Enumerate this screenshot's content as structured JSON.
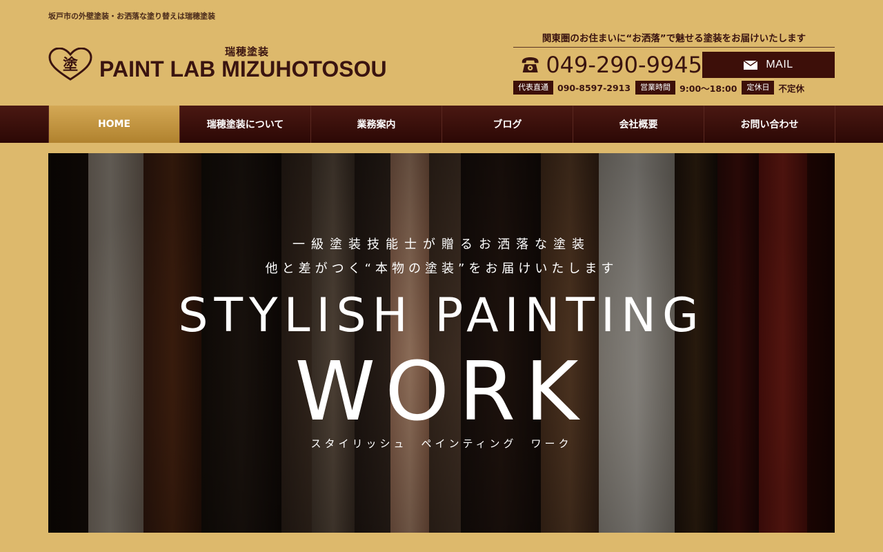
{
  "header": {
    "tagline": "坂戸市の外壁塗装・お洒落な塗り替えは瑞穂塗装",
    "logo_sub": "瑞穂塗装",
    "logo_main": "PAINT LAB MIZUHOTOSOU",
    "logo_icon": "heart-paint-icon",
    "catch": "関東圏のお住まいに“お洒落”で魅せる塗装をお届けいたします",
    "phone": "049-290-9945",
    "mail_label": "MAIL",
    "tag_direct": "代表直通",
    "direct_number": "090-8597-2913",
    "tag_hours": "営業時間",
    "hours": "9:00〜18:00",
    "tag_holiday": "定休日",
    "holiday": "不定休"
  },
  "nav": {
    "items": [
      {
        "label": "HOME"
      },
      {
        "label": "瑞穂塗装について"
      },
      {
        "label": "業務案内"
      },
      {
        "label": "ブログ"
      },
      {
        "label": "会社概要"
      },
      {
        "label": "お問い合わせ"
      }
    ]
  },
  "hero": {
    "line1": "一級塗装技能士が贈るお洒落な塗装",
    "line2": "他と差がつく“本物の塗装”をお届けいたします",
    "title": "STYLISH PAINTING",
    "work": "WORK",
    "kana": "スタイリッシュ　ペインティング　ワーク"
  },
  "colors": {
    "background": "#ddb96c",
    "dark": "#3d0f09",
    "nav_active": "#c39540"
  }
}
